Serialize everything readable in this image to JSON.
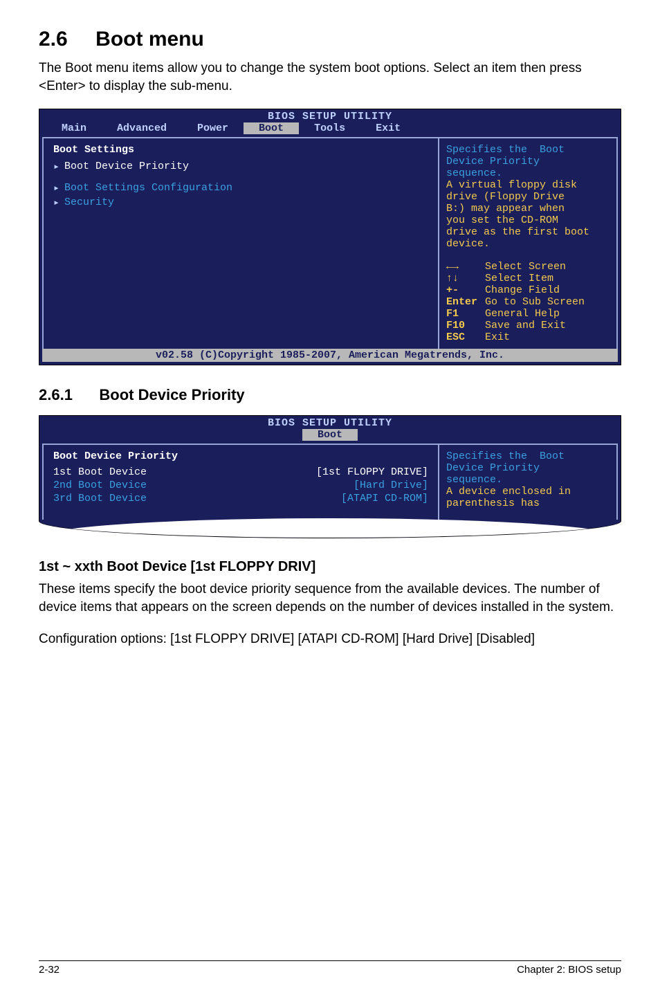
{
  "heading": {
    "number": "2.6",
    "title": "Boot menu"
  },
  "intro": "The Boot menu items allow you to change the system boot options. Select an item then press <Enter> to display the sub-menu.",
  "bios1": {
    "title": "BIOS SETUP UTILITY",
    "tabs": [
      "Main",
      "Advanced",
      "Power",
      "Boot",
      "Tools",
      "Exit"
    ],
    "active_tab": "Boot",
    "left": {
      "header": "Boot Settings",
      "items": [
        {
          "label": "Boot Device Priority",
          "selected": true
        },
        {
          "label": "Boot Settings Configuration",
          "selected": false
        },
        {
          "label": "Security",
          "selected": false
        }
      ]
    },
    "right": {
      "help": [
        "Specifies the  Boot",
        "Device Priority",
        "sequence.",
        "",
        "A virtual floppy disk",
        "drive (Floppy Drive",
        "B:) may appear when",
        "you set the CD-ROM",
        "drive as the first boot",
        "device."
      ],
      "keys": [
        {
          "k": "←→",
          "d": "Select Screen"
        },
        {
          "k": "↑↓",
          "d": "Select Item"
        },
        {
          "k": "+-",
          "d": "Change Field"
        },
        {
          "k": "Enter",
          "d": "Go to Sub Screen"
        },
        {
          "k": "F1",
          "d": "General Help"
        },
        {
          "k": "F10",
          "d": "Save and Exit"
        },
        {
          "k": "ESC",
          "d": "Exit"
        }
      ]
    },
    "footer": "v02.58 (C)Copyright 1985-2007, American Megatrends, Inc."
  },
  "sub": {
    "number": "2.6.1",
    "title": "Boot Device Priority"
  },
  "bios2": {
    "title": "BIOS SETUP UTILITY",
    "tab": "Boot",
    "left": {
      "header": "Boot Device Priority",
      "rows": [
        {
          "label": "1st Boot Device",
          "value": "[1st FLOPPY DRIVE]",
          "sel": true
        },
        {
          "label": "2nd Boot Device",
          "value": "[Hard Drive]",
          "sel": false
        },
        {
          "label": "3rd Boot Device",
          "value": "[ATAPI CD-ROM]",
          "sel": false
        }
      ]
    },
    "right": [
      "Specifies the  Boot",
      "Device Priority",
      "sequence.",
      "",
      "A device enclosed in",
      "parenthesis has"
    ]
  },
  "config_head": "1st ~ xxth Boot Device [1st FLOPPY DRIV]",
  "config_body1": "These items specify the boot device priority sequence from the available devices. The number of device items that appears on the screen depends on the number of devices installed in the system.",
  "config_body2": "Configuration options: [1st FLOPPY DRIVE] [ATAPI CD-ROM] [Hard Drive] [Disabled]",
  "footer": {
    "left": "2-32",
    "right": "Chapter 2: BIOS setup"
  }
}
